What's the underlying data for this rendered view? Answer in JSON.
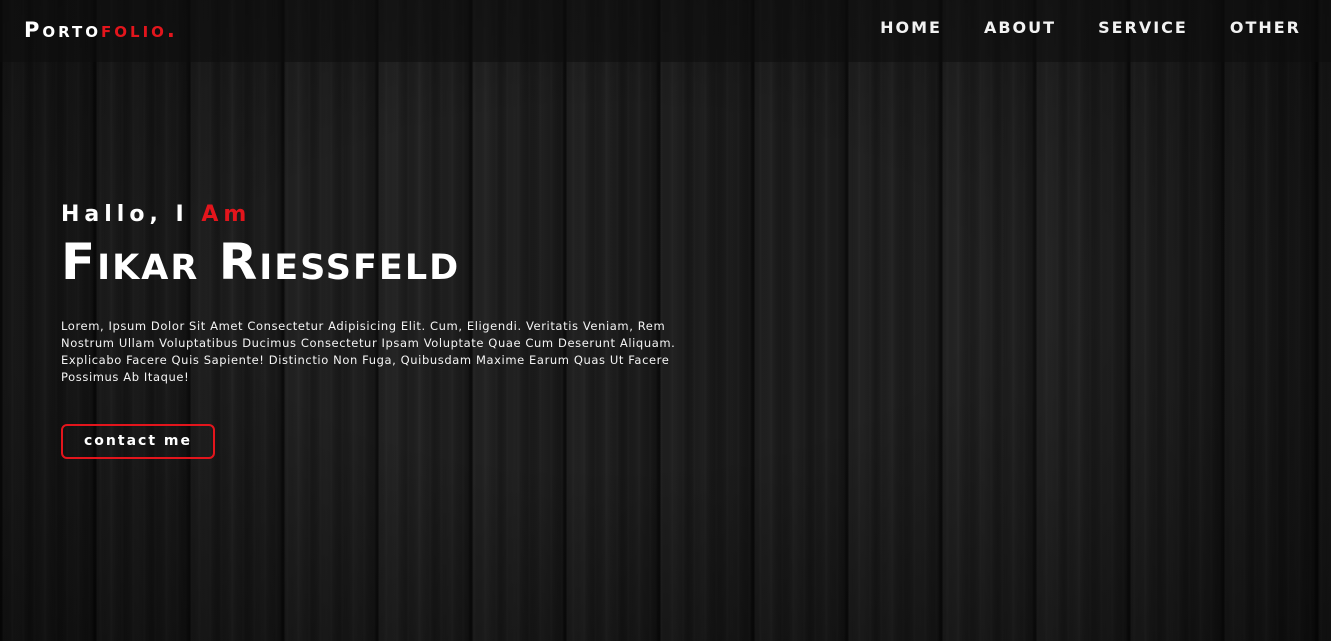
{
  "colors": {
    "accent": "#e3151c",
    "text": "#ffffff",
    "background": "#161616"
  },
  "logo": {
    "part1": "Porto",
    "part2": "folio."
  },
  "nav": {
    "items": [
      {
        "label": "HOME"
      },
      {
        "label": "ABOUT"
      },
      {
        "label": "SERVICE"
      },
      {
        "label": "OTHER"
      }
    ]
  },
  "hero": {
    "greeting": "Hallo, I",
    "greeting_highlight": "Am",
    "name": "Fikar Riessfeld",
    "description": "Lorem, Ipsum Dolor Sit Amet Consectetur Adipisicing Elit. Cum, Eligendi. Veritatis Veniam, Rem Nostrum Ullam Voluptatibus Ducimus Consectetur Ipsam Voluptate Quae Cum Deserunt Aliquam. Explicabo Facere Quis Sapiente! Distinctio Non Fuga, Quibusdam Maxime Earum Quas Ut Facere Possimus Ab Itaque!",
    "cta_label": "contact me"
  }
}
